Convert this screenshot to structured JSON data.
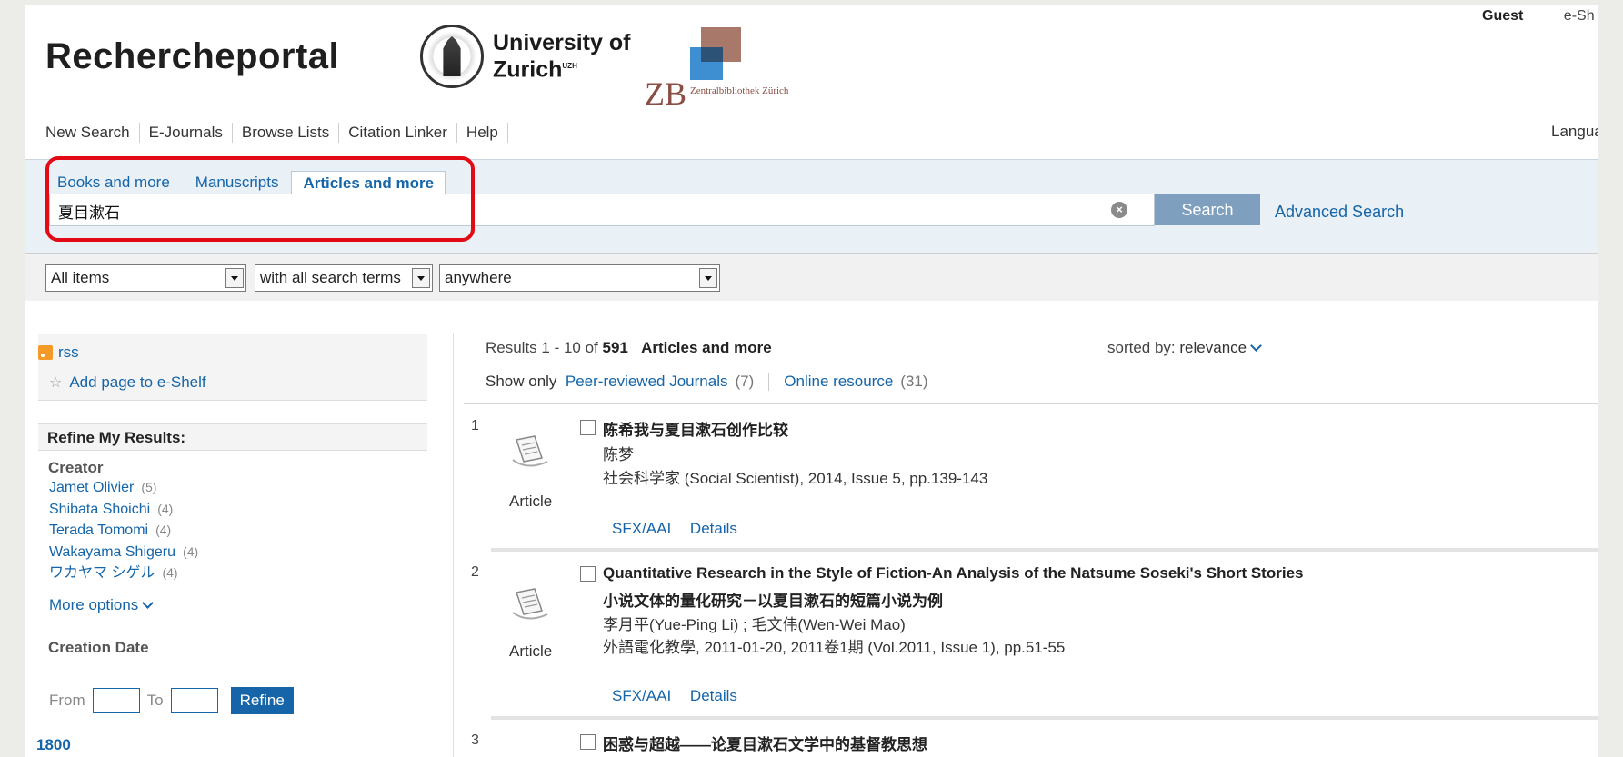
{
  "userbar": {
    "guest": "Guest",
    "eshelf": "e-Sh"
  },
  "brand": "Rechercheportal",
  "uzh": {
    "line1": "University of",
    "line2": "Zurich",
    "mark": "UZH"
  },
  "zb": {
    "letters": "ZB",
    "sub": "Zentralbibliothek Zürich"
  },
  "nav": [
    "New Search",
    "E-Journals",
    "Browse Lists",
    "Citation Linker",
    "Help"
  ],
  "language": "Languag",
  "search": {
    "tabs": [
      "Books and more",
      "Manuscripts",
      "Articles and more"
    ],
    "active_tab": "Articles and more",
    "query": "夏目漱石",
    "button": "Search",
    "advanced": "Advanced Search"
  },
  "filters": {
    "scope": "All items",
    "match": "with all search terms",
    "field": "anywhere"
  },
  "sidebar": {
    "rss": "rss",
    "add_page": "Add page to e-Shelf",
    "refine_heading": "Refine My Results:",
    "creator_title": "Creator",
    "creators": [
      {
        "name": "Jamet Olivier",
        "count": "(5)"
      },
      {
        "name": "Shibata Shoichi",
        "count": "(4)"
      },
      {
        "name": "Terada Tomomi",
        "count": "(4)"
      },
      {
        "name": "Wakayama Shigeru",
        "count": "(4)"
      },
      {
        "name": "ワカヤマ シゲル",
        "count": "(4)"
      }
    ],
    "more_options": "More options",
    "date_title": "Creation Date",
    "from": "From",
    "to": "To",
    "refine_button": "Refine",
    "year": "1800"
  },
  "results": {
    "summary_prefix": "Results 1 - 10 of",
    "total": "591",
    "collection": "Articles and more",
    "sorted_label": "sorted by:",
    "sorted_value": "relevance",
    "page": "1",
    "show_only": "Show only",
    "filter1": {
      "label": "Peer-reviewed Journals",
      "count": "(7)"
    },
    "filter2": {
      "label": "Online resource",
      "count": "(31)"
    },
    "items": [
      {
        "num": "1",
        "type": "Article",
        "title": "陈希我与夏目漱石创作比较",
        "subtitle": "",
        "author": "陈梦",
        "source": "社会科学家 (Social Scientist), 2014, Issue 5, pp.139-143",
        "link1": "SFX/AAI",
        "link2": "Details"
      },
      {
        "num": "2",
        "type": "Article",
        "title": "Quantitative Research in the Style of Fiction-An Analysis of the Natsume Soseki's Short Stories",
        "subtitle": "小说文体的量化研究－以夏目漱石的短篇小说为例",
        "author": "李月平(Yue-Ping Li) ; 毛文伟(Wen-Wei Mao)",
        "source": "外語電化教學, 2011-01-20, 2011卷1期 (Vol.2011, Issue 1), pp.51-55",
        "link1": "SFX/AAI",
        "link2": "Details"
      },
      {
        "num": "3",
        "type": "",
        "title": "困惑与超越——论夏目漱石文学中的基督教思想",
        "subtitle": "",
        "author": "",
        "source": "",
        "link1": "",
        "link2": ""
      }
    ]
  },
  "colors": {
    "accent": "#1565a8",
    "highlight": "#e20b15",
    "search_button": "#7f9fbe"
  }
}
